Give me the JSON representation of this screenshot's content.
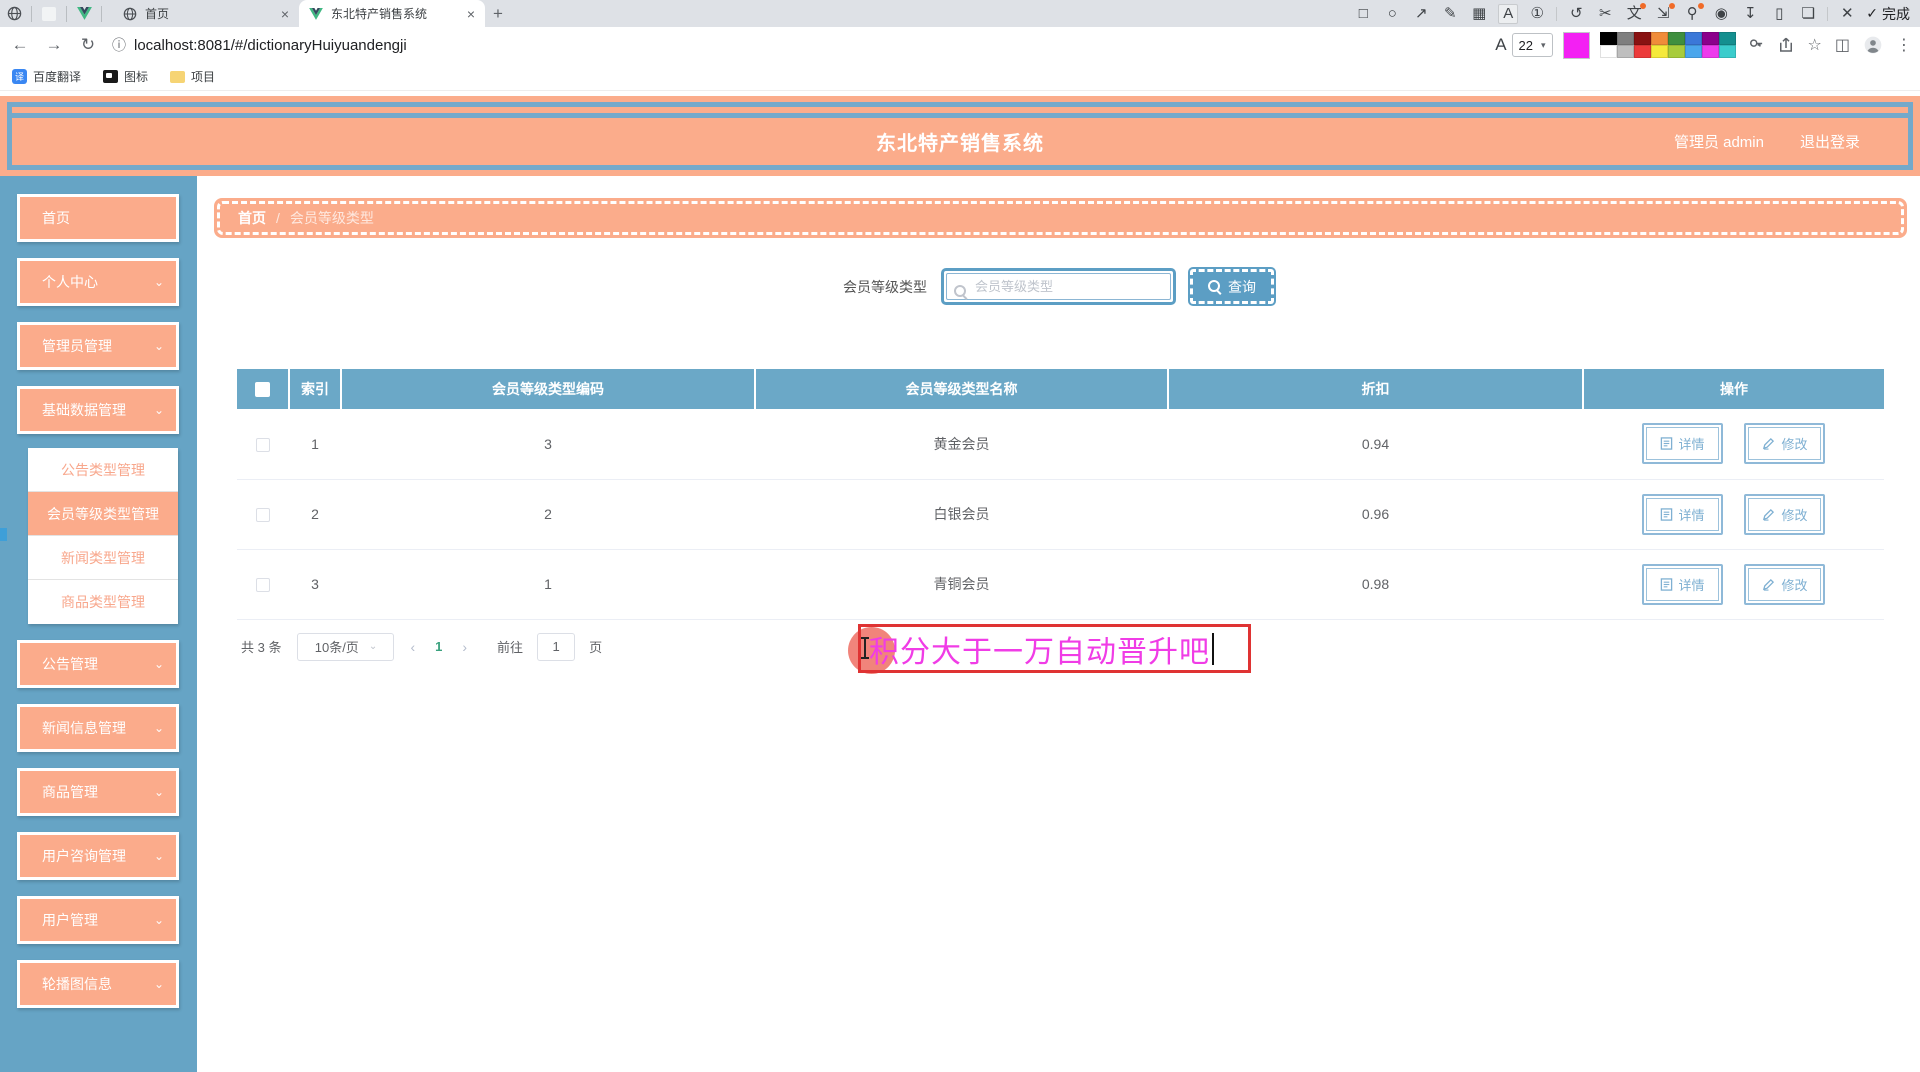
{
  "browser": {
    "pinned_tabs": [
      {
        "icon": "globe-icon"
      },
      {
        "icon": "blank-tab-icon"
      },
      {
        "icon": "vue-icon"
      }
    ],
    "tabs": [
      {
        "title": "首页",
        "favicon": "globe",
        "close_glyph": "×"
      },
      {
        "title": "东北特产销售系统",
        "favicon": "vue",
        "active": true,
        "close_glyph": "×"
      }
    ],
    "new_tab_glyph": "+",
    "nav": {
      "back": "←",
      "forward": "→",
      "reload": "↻",
      "info": "ⓘ"
    },
    "url": "localhost:8081/#/dictionaryHuiyuandengji",
    "bookmarks": [
      {
        "label": "百度翻译",
        "icon": "translate-favicon",
        "badge": "译"
      },
      {
        "label": "图标",
        "icon": "image-favicon"
      },
      {
        "label": "项目",
        "icon": "folder-favicon"
      }
    ],
    "menu_dots": "⋮",
    "star_glyph": "☆",
    "sidebar_toggle_glyph": "◫",
    "annotation_toolbar": {
      "tools": [
        {
          "name": "rect",
          "glyph": "□"
        },
        {
          "name": "ellipse",
          "glyph": "○"
        },
        {
          "name": "arrow",
          "glyph": "↗"
        },
        {
          "name": "pen",
          "glyph": "✎"
        },
        {
          "name": "mosaic",
          "glyph": "▦"
        },
        {
          "name": "text",
          "glyph": "A",
          "selected": true
        },
        {
          "name": "number",
          "glyph": "①"
        },
        {
          "name": "undo",
          "glyph": "↺"
        },
        {
          "name": "crop",
          "glyph": "✂"
        },
        {
          "name": "translate",
          "glyph": "文",
          "badge": true
        },
        {
          "name": "resize",
          "glyph": "⇲",
          "badge": true
        },
        {
          "name": "pin",
          "glyph": "⚲",
          "badge": true
        },
        {
          "name": "record",
          "glyph": "◉"
        },
        {
          "name": "download",
          "glyph": "↧"
        },
        {
          "name": "phone",
          "glyph": "▯"
        },
        {
          "name": "bookmark",
          "glyph": "❏"
        },
        {
          "name": "close",
          "glyph": "✕"
        },
        {
          "name": "done",
          "glyph": "✓",
          "label": "完成"
        }
      ],
      "font_tool": {
        "glyph": "A",
        "size": "22",
        "dropdown": "▾"
      },
      "current_color": "#f320f3",
      "palette": [
        "#000000",
        "#7f7f7f",
        "#891212",
        "#f08c3a",
        "#3f8f3f",
        "#3b78d8",
        "#8b008b",
        "#148f8f",
        "#ffffff",
        "#bfbfbf",
        "#ec3b3b",
        "#f5e93b",
        "#a8cc3c",
        "#4ba6ec",
        "#ec3bec",
        "#3bcccc"
      ]
    }
  },
  "header": {
    "title": "东北特产销售系统",
    "admin_label": "管理员 admin",
    "logout_label": "退出登录"
  },
  "sidebar": {
    "items": [
      {
        "label": "首页",
        "arrow": ""
      },
      {
        "label": "个人中心",
        "arrow": "⌄"
      },
      {
        "label": "管理员管理",
        "arrow": "⌄"
      },
      {
        "label": "基础数据管理",
        "arrow": "⌄",
        "expanded": true,
        "children": [
          {
            "label": "公告类型管理"
          },
          {
            "label": "会员等级类型管理",
            "active": true
          },
          {
            "label": "新闻类型管理"
          },
          {
            "label": "商品类型管理"
          }
        ]
      },
      {
        "label": "公告管理",
        "arrow": "⌄"
      },
      {
        "label": "新闻信息管理",
        "arrow": "⌄"
      },
      {
        "label": "商品管理",
        "arrow": "⌄"
      },
      {
        "label": "用户咨询管理",
        "arrow": "⌄"
      },
      {
        "label": "用户管理",
        "arrow": "⌄"
      },
      {
        "label": "轮播图信息",
        "arrow": "⌄"
      }
    ]
  },
  "breadcrumb": {
    "home": "首页",
    "separator": "/",
    "current": "会员等级类型"
  },
  "search": {
    "label": "会员等级类型",
    "placeholder": "会员等级类型",
    "button": "查询"
  },
  "table": {
    "headers": [
      "索引",
      "会员等级类型编码",
      "会员等级类型名称",
      "折扣",
      "操作"
    ],
    "rows": [
      {
        "index": "1",
        "code": "3",
        "name": "黄金会员",
        "discount": "0.94"
      },
      {
        "index": "2",
        "code": "2",
        "name": "白银会员",
        "discount": "0.96"
      },
      {
        "index": "3",
        "code": "1",
        "name": "青铜会员",
        "discount": "0.98"
      }
    ],
    "detail_label": "详情",
    "edit_label": "修改"
  },
  "pagination": {
    "total": "共 3 条",
    "page_size": "10条/页",
    "size_dropdown": "⌄",
    "prev_glyph": "‹",
    "current_page": "1",
    "next_glyph": "›",
    "goto_label": "前往",
    "goto_value": "1",
    "page_label": "页"
  },
  "annotation": {
    "text": "积分大于一万自动晋升吧"
  },
  "colors": {
    "salmon": "#fbab8b",
    "sidebar_blue": "#66a4c5",
    "table_header_blue": "#6ba8c7",
    "button_blue": "#5c9ec4",
    "page_current_teal": "#3aa17e",
    "annotation_red": "#df3333",
    "annotation_magenta": "#f03ce6"
  }
}
